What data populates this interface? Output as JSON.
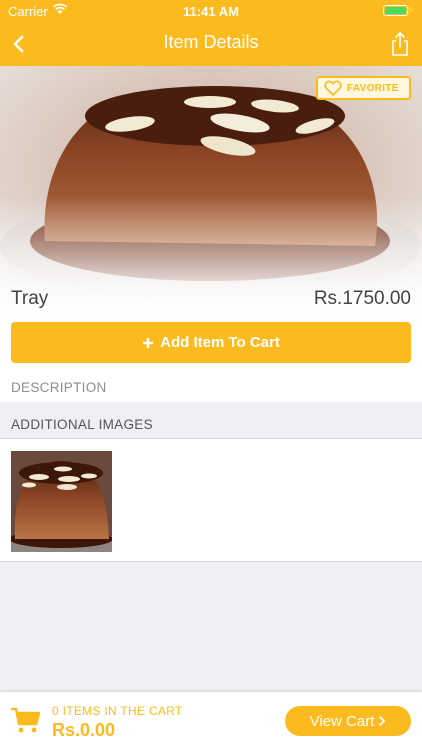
{
  "status": {
    "carrier": "Carrier",
    "time": "11:41 AM"
  },
  "nav": {
    "title": "Item Details"
  },
  "favorite": {
    "label": "FAVORITE"
  },
  "item": {
    "name": "Tray",
    "price": "Rs.1750.00"
  },
  "cart": {
    "add_label": "Add Item To Cart"
  },
  "sections": {
    "description": "DESCRIPTION",
    "additional_images": "ADDITIONAL IMAGES"
  },
  "cartbar": {
    "count": "0 ITEMS IN THE CART",
    "total": "Rs.0.00",
    "view_label": "View Cart"
  },
  "colors": {
    "accent": "#fbbb1e",
    "battery": "#4cd964"
  },
  "icons": {
    "back": "chevron-left-icon",
    "share": "share-icon",
    "favorite": "heart-icon",
    "add": "plus-icon",
    "cart": "cart-icon",
    "view": "chevron-right-icon"
  }
}
